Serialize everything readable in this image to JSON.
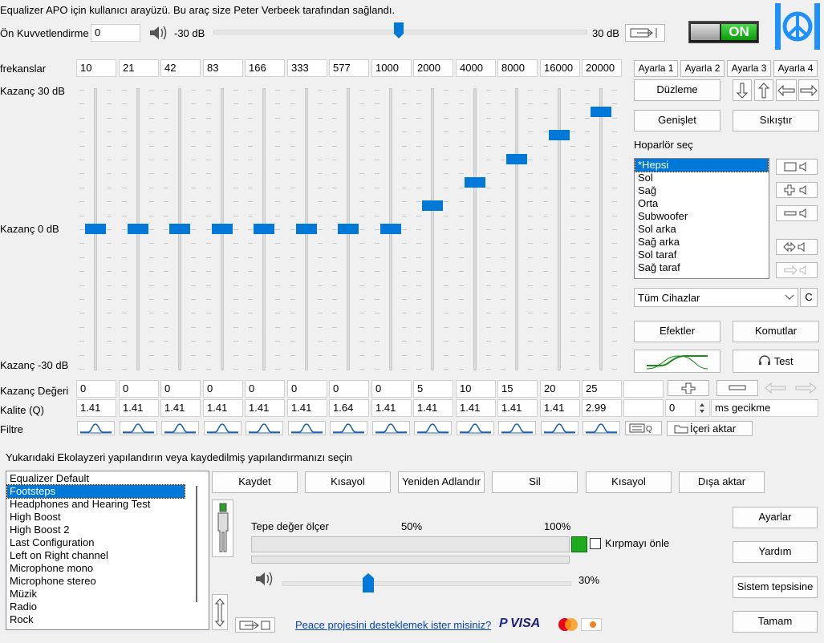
{
  "header": {
    "description": "Equalizer APO için kullanıcı arayüzü. Bu araç size Peter Verbeek tarafından sağlandı.",
    "preamp_label": "Ön Kuvvetlendirme",
    "preamp_value": "0",
    "preamp_min": "-30 dB",
    "preamp_max": "30 dB",
    "power_label": "ON"
  },
  "eq": {
    "freq_label": "frekanslar",
    "gain_top_label": "Kazanç 30 dB",
    "gain_mid_label": "Kazanç 0 dB",
    "gain_bottom_label": "Kazanç -30 dB",
    "gain_row_label": "Kazanç Değeri",
    "q_row_label": "Kalite (Q)",
    "filter_row_label": "Filtre",
    "bands": [
      {
        "freq": "10",
        "gain": "0",
        "q": "1.41"
      },
      {
        "freq": "21",
        "gain": "0",
        "q": "1.41"
      },
      {
        "freq": "42",
        "gain": "0",
        "q": "1.41"
      },
      {
        "freq": "83",
        "gain": "0",
        "q": "1.41"
      },
      {
        "freq": "166",
        "gain": "0",
        "q": "1.41"
      },
      {
        "freq": "333",
        "gain": "0",
        "q": "1.41"
      },
      {
        "freq": "577",
        "gain": "0",
        "q": "1.64"
      },
      {
        "freq": "1000",
        "gain": "0",
        "q": "1.41"
      },
      {
        "freq": "2000",
        "gain": "5",
        "q": "1.41"
      },
      {
        "freq": "4000",
        "gain": "10",
        "q": "1.41"
      },
      {
        "freq": "8000",
        "gain": "15",
        "q": "1.41"
      },
      {
        "freq": "16000",
        "gain": "20",
        "q": "1.41"
      },
      {
        "freq": "20000",
        "gain": "25",
        "q": "2.99"
      }
    ],
    "delay_value": "0",
    "delay_unit": "ms gecikme"
  },
  "right": {
    "presets": [
      "Ayarla 1",
      "Ayarla 2",
      "Ayarla 3",
      "Ayarla 4"
    ],
    "flatten": "Düzleme",
    "expand": "Genişlet",
    "compress": "Sıkıştır",
    "speaker_label": "Hoparlör seç",
    "speakers": [
      "*Hepsi",
      "Sol",
      "Sağ",
      "Orta",
      "Subwoofer",
      "Sol arka",
      "Sağ arka",
      "Sol taraf",
      "Sağ taraf"
    ],
    "device": "Tüm Cihazlar",
    "device_btn": "C",
    "effects": "Efektler",
    "commands": "Komutlar",
    "test": "Test",
    "import": "İçeri aktar"
  },
  "configs": {
    "label": "Yukarıdaki Ekolayzeri yapılandırın veya kaydedilmiş yapılandırmanızı seçin",
    "items": [
      "Equalizer Default",
      "Footsteps",
      "Headphones and Hearing Test",
      "High Boost",
      "High Boost 2",
      "Last Configuration",
      "Left on Right channel",
      "Microphone mono",
      "Microphone stereo",
      "Müzik",
      "Radio",
      "Rock"
    ],
    "save": "Kaydet",
    "shortcut1": "Kısayol",
    "rename": "Yeniden Adlandır",
    "delete": "Sil",
    "shortcut2": "Kısayol",
    "export": "Dışa aktar"
  },
  "meter": {
    "label": "Tepe değer ölçer",
    "mid": "50%",
    "max": "100%",
    "clip_label": "Kırpmayı önle",
    "volume_pct": "30%",
    "volume_fraction": 0.3
  },
  "side_buttons": {
    "settings": "Ayarlar",
    "help": "Yardım",
    "tray": "Sistem tepsisine",
    "ok": "Tamam"
  },
  "footer": {
    "donate": "Peace projesini desteklemek ister misiniz?",
    "paypal": "PayPal",
    "visa": "VISA"
  }
}
